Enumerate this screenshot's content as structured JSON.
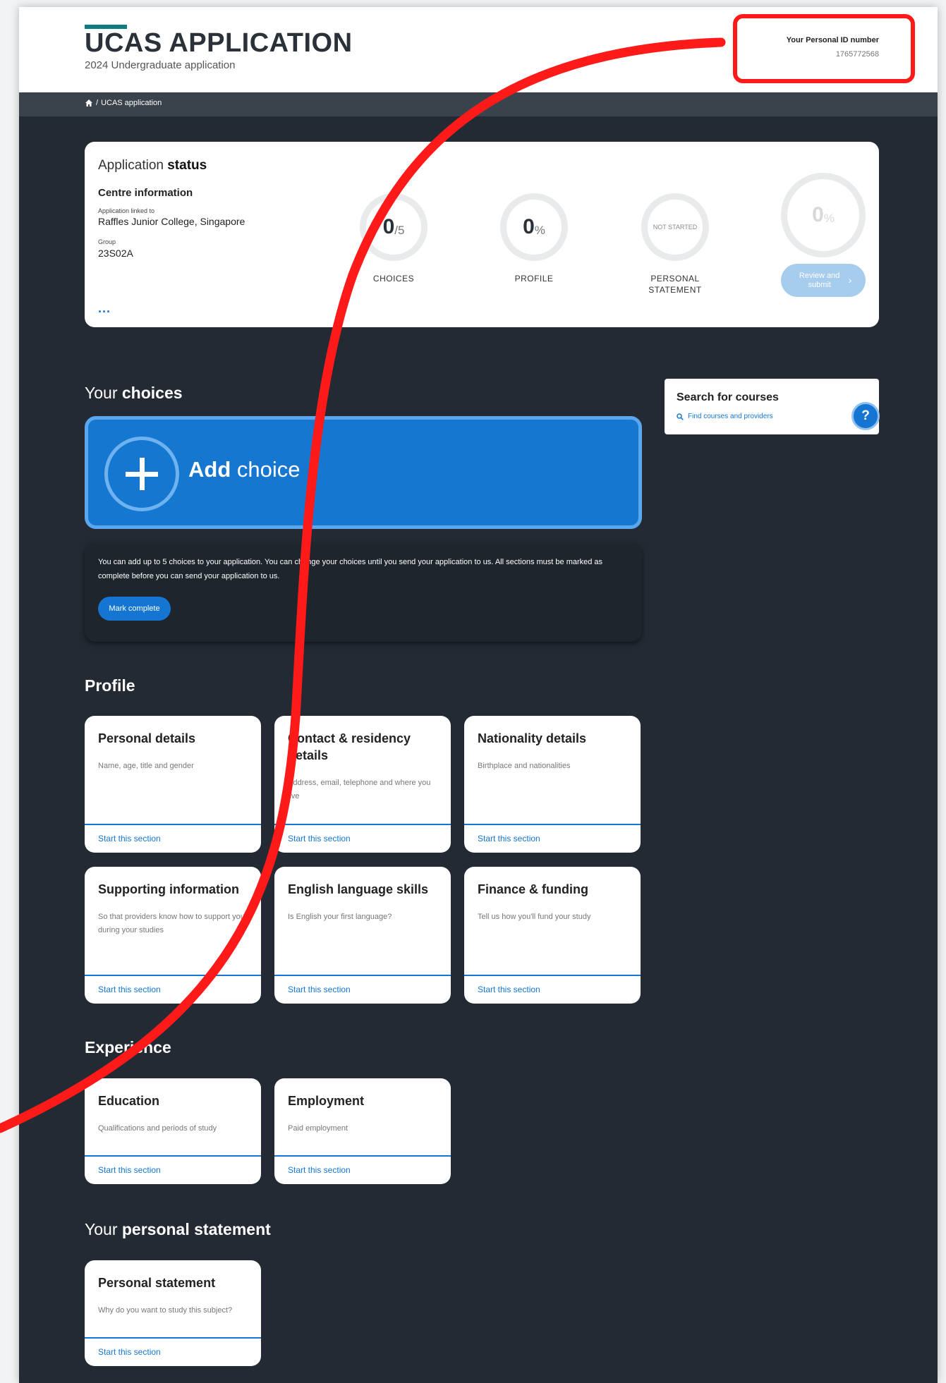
{
  "header": {
    "title": "UCAS APPLICATION",
    "subtitle": "2024 Undergraduate application",
    "personal_id_label": "Your Personal ID number",
    "personal_id_value": "1765772568"
  },
  "breadcrumb": {
    "current": "UCAS application"
  },
  "status": {
    "title_prefix": "Application",
    "title_bold": "status",
    "centre_heading": "Centre information",
    "linked_label": "Application linked to",
    "linked_value": "Raffles Junior College, Singapore",
    "group_label": "Group",
    "group_value": "23S02A",
    "more": "...",
    "choices": {
      "value": "0",
      "suffix": "/5",
      "label": "CHOICES"
    },
    "profile": {
      "value": "0",
      "suffix": "%",
      "label": "PROFILE"
    },
    "statement": {
      "value": "NOT STARTED",
      "label": "PERSONAL STATEMENT"
    },
    "overall": {
      "value": "0",
      "suffix": "%"
    },
    "review_button": "Review and submit"
  },
  "choices_section": {
    "title_prefix": "Your",
    "title_bold": "choices",
    "add_bold": "Add",
    "add_rest": "choice",
    "info": "You can add up to 5 choices to your application. You can change your choices until you send your application to us. All sections must be marked as complete before you can send your application to us.",
    "mark_complete": "Mark complete"
  },
  "search": {
    "title": "Search for courses",
    "link": "Find courses and providers",
    "help": "?"
  },
  "profile_section": {
    "title": "Profile",
    "tiles": [
      {
        "title": "Personal details",
        "desc": "Name, age, title and gender",
        "link": "Start this section"
      },
      {
        "title": "Contact & residency details",
        "desc": "Address, email, telephone and where you live",
        "link": "Start this section"
      },
      {
        "title": "Nationality details",
        "desc": "Birthplace and nationalities",
        "link": "Start this section"
      },
      {
        "title": "Supporting information",
        "desc": "So that providers know how to support you during your studies",
        "link": "Start this section"
      },
      {
        "title": "English language skills",
        "desc": "Is English your first language?",
        "link": "Start this section"
      },
      {
        "title": "Finance & funding",
        "desc": "Tell us how you'll fund your study",
        "link": "Start this section"
      }
    ]
  },
  "experience_section": {
    "title": "Experience",
    "tiles": [
      {
        "title": "Education",
        "desc": "Qualifications and periods of study",
        "link": "Start this section"
      },
      {
        "title": "Employment",
        "desc": "Paid employment",
        "link": "Start this section"
      }
    ]
  },
  "statement_section": {
    "title_prefix": "Your",
    "title_bold": "personal statement",
    "tile": {
      "title": "Personal statement",
      "desc": "Why do you want to study this subject?",
      "link": "Start this section"
    }
  },
  "colors": {
    "background": "#232a33",
    "accent": "#1476d2",
    "annotation": "#ff1a1a"
  }
}
